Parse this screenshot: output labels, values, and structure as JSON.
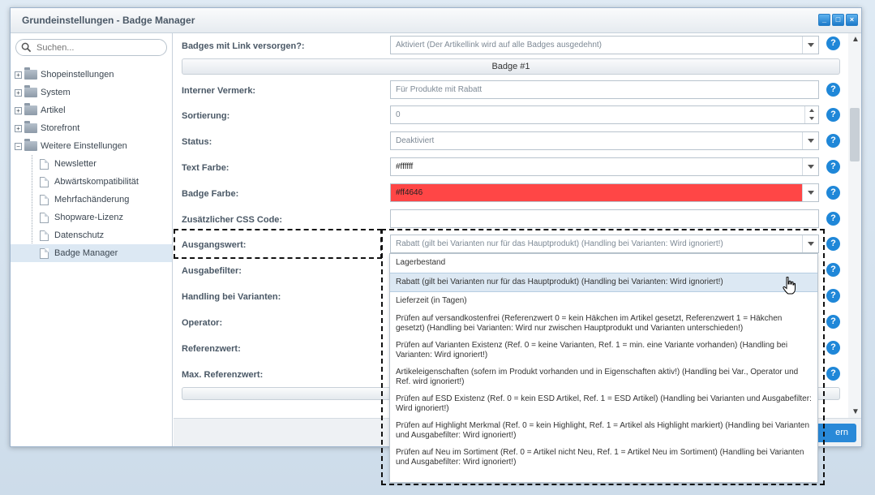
{
  "window": {
    "title": "Grundeinstellungen - Badge Manager"
  },
  "sidebar": {
    "search_placeholder": "Suchen...",
    "folders": [
      {
        "label": "Shopeinstellungen"
      },
      {
        "label": "System"
      },
      {
        "label": "Artikel"
      },
      {
        "label": "Storefront"
      },
      {
        "label": "Weitere Einstellungen"
      }
    ],
    "children": [
      {
        "label": "Newsletter"
      },
      {
        "label": "Abwärtskompatibilität"
      },
      {
        "label": "Mehrfachänderung"
      },
      {
        "label": "Shopware-Lizenz"
      },
      {
        "label": "Datenschutz"
      },
      {
        "label": "Badge Manager"
      }
    ]
  },
  "form": {
    "link_label": "Badges mit Link versorgen?:",
    "link_value": "Aktiviert (Der Artikellink wird auf alle Badges ausgedehnt)",
    "badge_header": "Badge #1",
    "note_label": "Interner Vermerk:",
    "note_value": "Für Produkte mit Rabatt",
    "sort_label": "Sortierung:",
    "sort_value": "0",
    "status_label": "Status:",
    "status_value": "Deaktiviert",
    "text_color_label": "Text Farbe:",
    "text_color_value": "#ffffff",
    "badge_color_label": "Badge Farbe:",
    "badge_color_value": "#ff4646",
    "css_label": "Zusätzlicher CSS Code:",
    "css_value": "",
    "source_label": "Ausgangswert:",
    "source_value": "Rabatt (gilt bei Varianten nur für das Hauptprodukt) (Handling bei Varianten: Wird ignoriert!)",
    "output_filter_label": "Ausgabefilter:",
    "variant_label": "Handling bei Varianten:",
    "operator_label": "Operator:",
    "ref_label": "Referenzwert:",
    "max_ref_label": "Max. Referenzwert:",
    "help_glyph": "?"
  },
  "dropdown": {
    "options": [
      "Lagerbestand",
      "Rabatt (gilt bei Varianten nur für das Hauptprodukt) (Handling bei Varianten: Wird ignoriert!)",
      "Lieferzeit (in Tagen)",
      "Prüfen auf versandkostenfrei (Referenzwert 0 = kein Häkchen im Artikel gesetzt, Referenzwert 1 = Häkchen gesetzt) (Handling bei Varianten: Wird nur zwischen Hauptprodukt und Varianten unterschieden!)",
      "Prüfen auf Varianten Existenz (Ref. 0 = keine Varianten, Ref. 1 = min. eine Variante vorhanden) (Handling bei Varianten: Wird ignoriert!)",
      "Artikeleigenschaften (sofern im Produkt vorhanden und in Eigenschaften aktiv!) (Handling bei Var., Operator und Ref. wird ignoriert!)",
      "Prüfen auf ESD Existenz (Ref. 0 = kein ESD Artikel, Ref. 1 = ESD Artikel) (Handling bei Varianten und Ausgabefilter: Wird ignoriert!)",
      "Prüfen auf Highlight Merkmal (Ref. 0 = kein Highlight, Ref. 1 = Artikel als Highlight markiert) (Handling bei Varianten und Ausgabefilter: Wird ignoriert!)",
      "Prüfen auf Neu im Sortiment (Ref. 0 = Artikel nicht Neu, Ref. 1 = Artikel Neu im Sortiment) (Handling bei Varianten und Ausgabefilter: Wird ignoriert!)"
    ]
  },
  "footer": {
    "save_label": "ern"
  }
}
